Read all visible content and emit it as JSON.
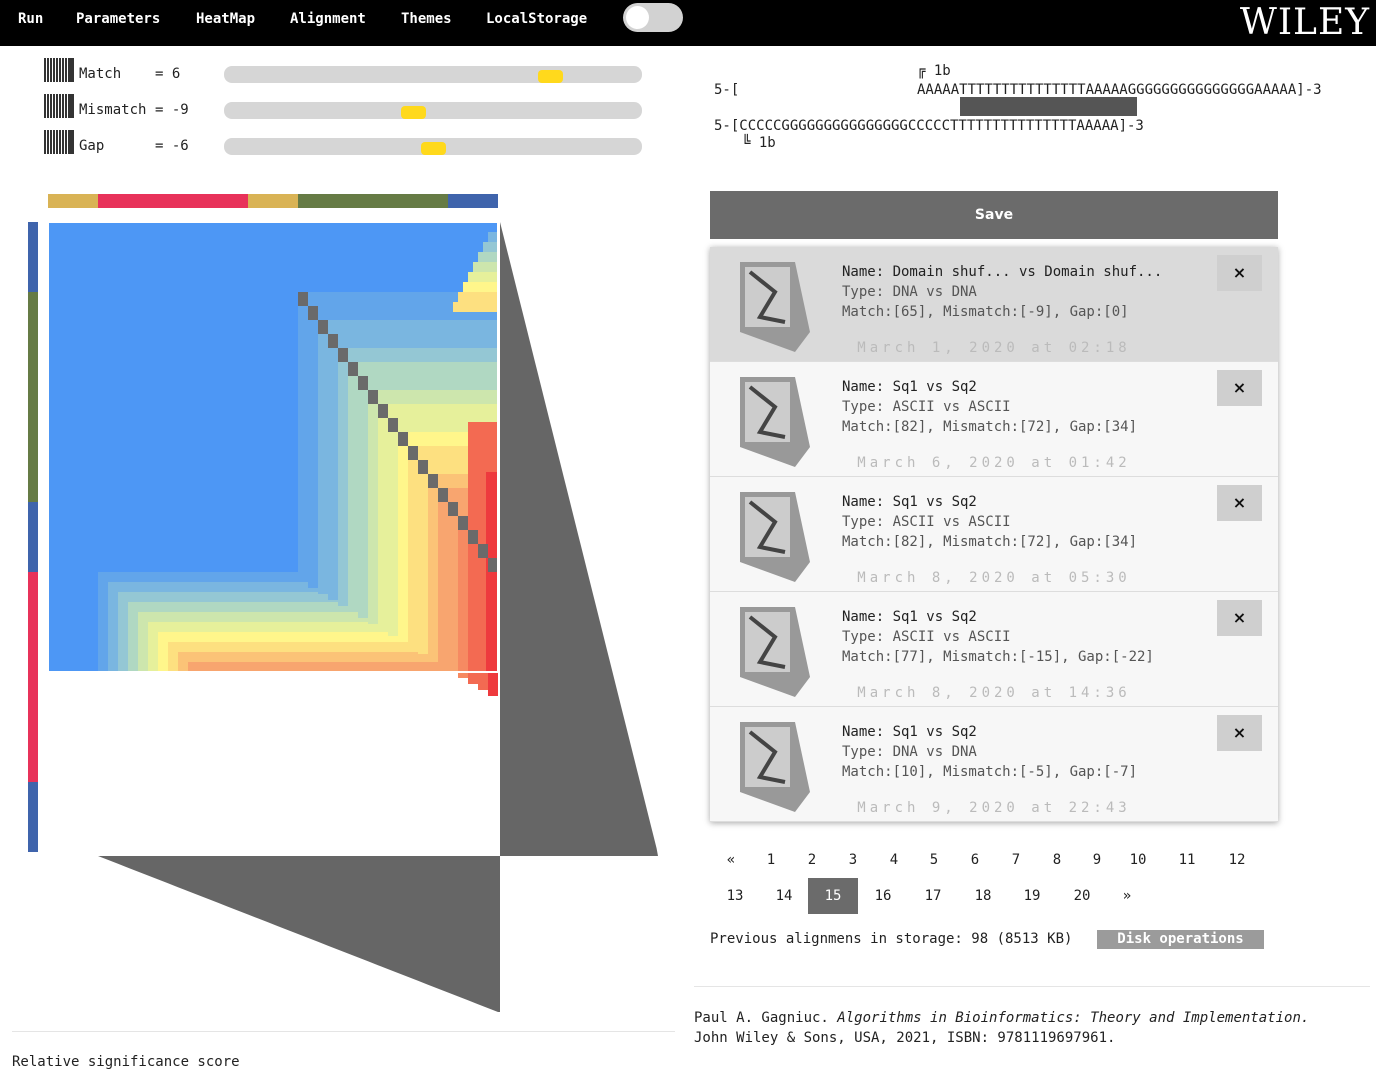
{
  "menu": [
    "Run",
    "Parameters",
    "HeatMap",
    "Alignment",
    "Themes",
    "LocalStorage"
  ],
  "brand": "WILEY",
  "params": [
    {
      "label": "Match",
      "eq": "= 6",
      "thumb_fraction": 0.8
    },
    {
      "label": "Mismatch",
      "eq": "= -9",
      "thumb_fraction": 0.45
    },
    {
      "label": "Gap",
      "eq": "= -6",
      "thumb_fraction": 0.5
    }
  ],
  "alignment": {
    "top_marker": "1b",
    "bottom_marker": "1b",
    "top_prefix": "5-[",
    "top_seq": "AAAAATTTTTTTTTTTTTTTAAAAAGGGGGGGGGGGGGGGAAAAA]-3",
    "bottom_seq": "5-[CCCCCGGGGGGGGGGGGGGGCCCCCTTTTTTTTTTTTTTTAAAAA]-3"
  },
  "save_label": "Save",
  "records": [
    {
      "name": "Name: Domain shuf... vs Domain shuf...",
      "type": "Type: DNA vs DNA",
      "params": "Match:[65], Mismatch:[-9], Gap:[0]",
      "date": "March 1, 2020 at 02:18",
      "selected": true
    },
    {
      "name": "Name: Sq1 vs Sq2",
      "type": "Type: ASCII vs ASCII",
      "params": "Match:[82], Mismatch:[72], Gap:[34]",
      "date": "March 6, 2020 at 01:42",
      "selected": false
    },
    {
      "name": "Name: Sq1 vs Sq2",
      "type": "Type: ASCII vs ASCII",
      "params": "Match:[82], Mismatch:[72], Gap:[34]",
      "date": "March 8, 2020 at 05:30",
      "selected": false
    },
    {
      "name": "Name: Sq1 vs Sq2",
      "type": "Type: ASCII vs ASCII",
      "params": "Match:[77], Mismatch:[-15], Gap:[-22]",
      "date": "March 8, 2020 at 14:36",
      "selected": false
    },
    {
      "name": "Name: Sq1 vs Sq2",
      "type": "Type: DNA vs DNA",
      "params": "Match:[10], Mismatch:[-5], Gap:[-7]",
      "date": "March 9, 2020 at 22:43",
      "selected": false
    }
  ],
  "close_label": "×",
  "pager": {
    "row1": [
      "«",
      "1",
      "2",
      "3",
      "4",
      "5",
      "6",
      "7",
      "8",
      "9",
      "10",
      "11",
      "12"
    ],
    "row2": [
      "13",
      "14",
      "15",
      "16",
      "17",
      "18",
      "19",
      "20",
      "»"
    ],
    "active": "15"
  },
  "storage_text": "Previous alignmens in storage: 98 (8513 KB)",
  "disk_label": "Disk operations",
  "citation": {
    "author": "Paul A. Gagniuc. ",
    "title": "Algorithms in Bioinformatics: Theory and Implementation.",
    "rest": "John Wiley & Sons, USA, 2021, ISBN: 9781119697961."
  },
  "relative_label": "Relative significance score",
  "colors": {
    "menu_bg": "#000000",
    "slider_thumb": "#ffd91c",
    "nucleotide_A": "#d9b355",
    "nucleotide_T": "#e8325a",
    "nucleotide_G": "#667b45",
    "nucleotide_C": "#3f64ac",
    "diagonal": "#6a6a6a",
    "score_low": "#4d97f5",
    "score_high": "#ee3a3e",
    "save_bg": "#6b6b6b"
  }
}
